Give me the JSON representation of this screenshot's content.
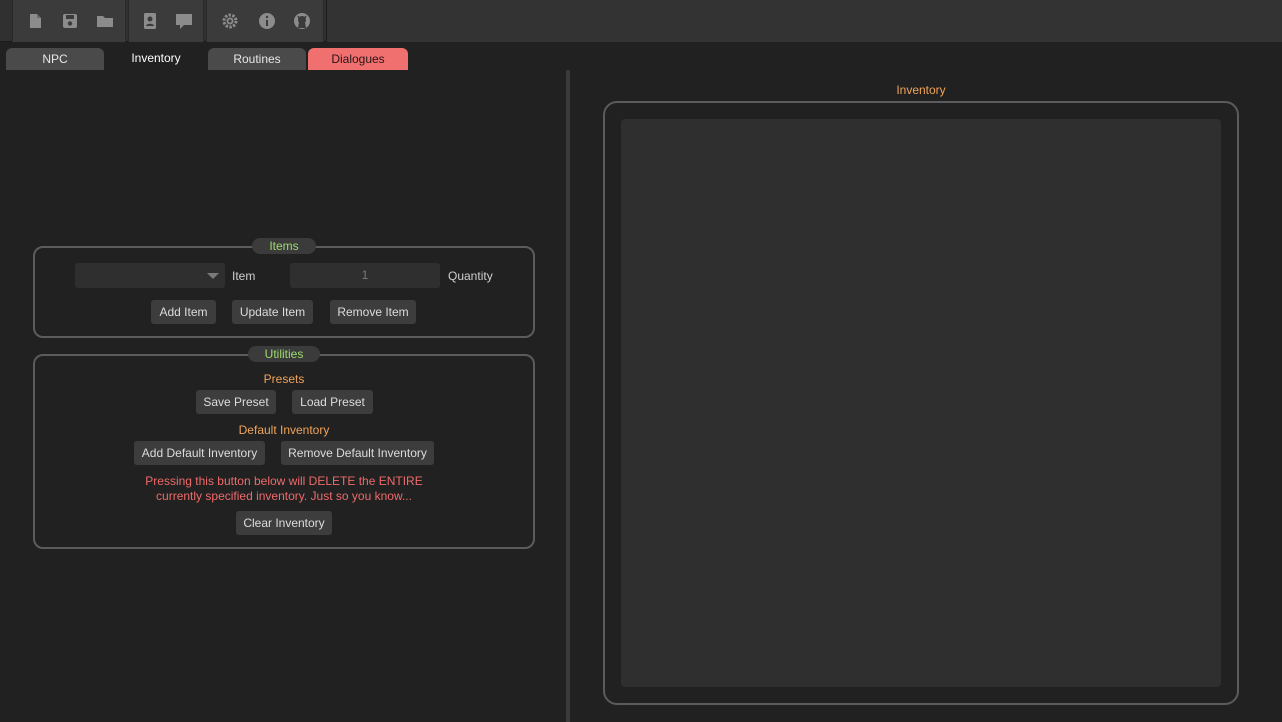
{
  "toolbar": {
    "icons": [
      "new-file-icon",
      "save-icon",
      "open-folder-icon",
      "contact-card-icon",
      "speech-bubble-icon",
      "gear-icon",
      "info-icon",
      "github-icon"
    ]
  },
  "tabs": {
    "npc": "NPC",
    "inventory": "Inventory",
    "routines": "Routines",
    "dialogues": "Dialogues"
  },
  "items_group": {
    "title": "Items",
    "item_select_value": "",
    "item_label": "Item",
    "quantity_value": "1",
    "quantity_label": "Quantity",
    "add_button": "Add Item",
    "update_button": "Update Item",
    "remove_button": "Remove Item"
  },
  "utilities_group": {
    "title": "Utilities",
    "presets_heading": "Presets",
    "save_preset_button": "Save Preset",
    "load_preset_button": "Load Preset",
    "default_inventory_heading": "Default Inventory",
    "add_default_button": "Add Default Inventory",
    "remove_default_button": "Remove Default Inventory",
    "warning_line1": "Pressing this button below will DELETE the ENTIRE",
    "warning_line2": "currently specified inventory. Just so you know...",
    "clear_button": "Clear Inventory"
  },
  "inventory_panel": {
    "title": "Inventory"
  },
  "colors": {
    "background": "#212121",
    "group_title": "#9ddc6a",
    "heading_orange": "#f0a35a",
    "warning_red": "#ef6a6a",
    "active_alert_tab": "#f07070"
  }
}
